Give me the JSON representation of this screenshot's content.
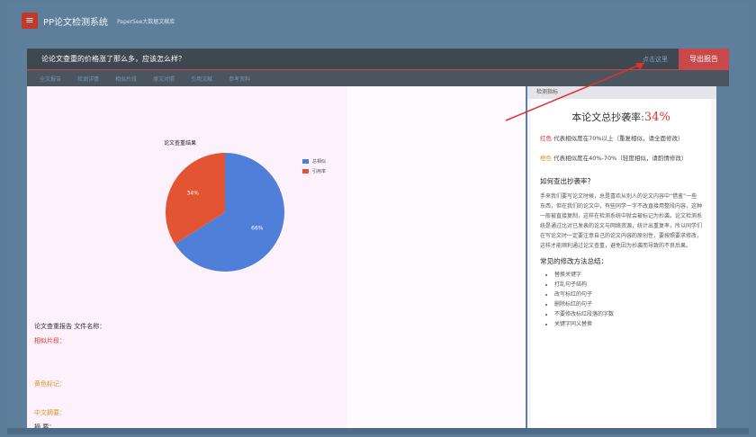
{
  "app": {
    "title": "PP论文检测系统",
    "subtitle": "PaperSee大数据文献库"
  },
  "question_bar": {
    "text": "论论文查重的价格涨了那么多，应该怎么样？",
    "link": "点击这里",
    "report_button": "导出报告"
  },
  "nav": {
    "items": [
      "全文报告",
      "检测详情",
      "相似片段",
      "原文对照",
      "引用文献",
      "参考资料"
    ]
  },
  "chart_data": {
    "type": "pie",
    "title": "论文查重结果",
    "series": [
      {
        "name": "总相似",
        "value": 66,
        "color": "#4f7fd8"
      },
      {
        "name": "引用率",
        "value": 34,
        "color": "#e35532"
      }
    ]
  },
  "details": {
    "lines": [
      {
        "text": "论文查重报告 文件名称：",
        "color": "#333333"
      },
      {
        "text": "相似片段：",
        "color": "#e0312e"
      },
      {
        "text": "",
        "color": "#e3932b"
      },
      {
        "text": "",
        "color": "#e3932b"
      },
      {
        "text": "黄色标记：",
        "color": "#e3932b"
      },
      {
        "text": "",
        "color": "#e3932b"
      },
      {
        "text": "中文摘要：",
        "color": "#e3932b"
      },
      {
        "text": "摘 要：",
        "color": "#333333"
      }
    ]
  },
  "right_panel": {
    "header": "检测指标",
    "rate_label": "本论文总抄袭率:",
    "rate_value": "34%",
    "red_tag": "红色",
    "red_desc": "代表相似度在70%以上（重复相似，请全面修改）",
    "orange_tag": "橙色",
    "orange_desc": "代表相似度在40%-70%（轻度相似，请酌情修改）",
    "how_title": "如何查出抄袭率？",
    "how_body": "手来我们要写论文时候，总是喜欢从别人的论文内容中“借鉴”一些东西，但在我们的论文中，有些同学一字不改直接用整段内容，这种一般被直接复制，这样在检测系统中就会被标记为抄袭。论文检测系统是通过比对已发表的论文与网络资源，统计出重复率，所以同学们在写论文时一定要注意自己的论文内容的原创性，要按照要求修改，这样才能顺利通过论文查重，避免因为抄袭而导致的不良后果。",
    "methods_title": "常见的修改方法总结：",
    "methods": [
      "替换关键字",
      "打乱句子结构",
      "改写标红的句子",
      "删除标红的句子",
      "不要修改标红段落的字数",
      "关键字同义替换"
    ]
  }
}
